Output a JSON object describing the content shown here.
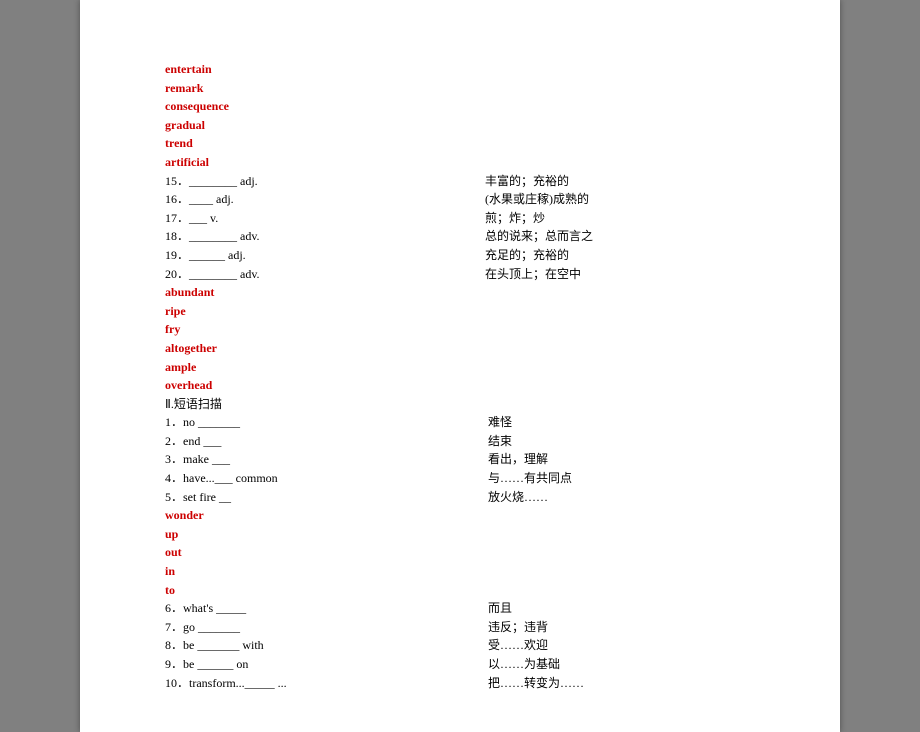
{
  "redWords1": [
    "entertain",
    "remark",
    "consequence",
    "gradual",
    "trend",
    "artificial"
  ],
  "items1": [
    {
      "left": "15．________ adj.",
      "right": "丰富的；充裕的"
    },
    {
      "left": "16．____ adj.",
      "right": "(水果或庄稼)成熟的"
    },
    {
      "left": "17．___ v.",
      "right": "煎；炸；炒"
    },
    {
      "left": "18．________ adv.",
      "right": "总的说来；总而言之"
    },
    {
      "left": "19．______ adj.",
      "right": "充足的；充裕的"
    },
    {
      "left": "20．________ adv.",
      "right": "在头顶上；在空中"
    }
  ],
  "redWords2": [
    "abundant",
    "ripe",
    "fry",
    "altogether",
    "ample",
    "overhead"
  ],
  "section2": "Ⅱ.短语扫描",
  "items2": [
    {
      "left": "1．no _______",
      "right": " 难怪"
    },
    {
      "left": "2．end ___",
      "right": " 结束"
    },
    {
      "left": "3．make ___",
      "right": " 看出，理解"
    },
    {
      "left": "4．have...___ common",
      "right": " 与……有共同点"
    },
    {
      "left": "5．set fire __",
      "right": " 放火烧……"
    }
  ],
  "redWords3": [
    "wonder",
    "up",
    "out",
    "in",
    "to"
  ],
  "items3": [
    {
      "left": "6．what's _____",
      "right": " 而且"
    },
    {
      "left": "7．go _______",
      "right": " 违反；违背"
    },
    {
      "left": "8．be _______ with",
      "right": " 受……欢迎"
    },
    {
      "left": "9．be ______ on",
      "right": " 以……为基础"
    },
    {
      "left": "10．transform..._____ ...",
      "right": " 把……转变为……"
    }
  ]
}
